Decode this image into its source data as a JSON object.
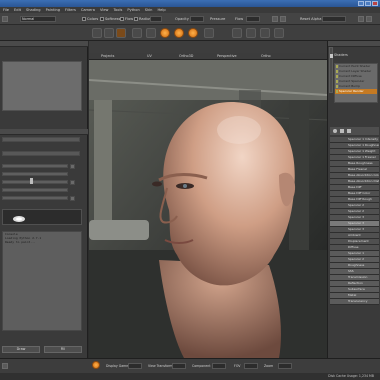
{
  "titlebar": {
    "title": ""
  },
  "menu": [
    "File",
    "Edit",
    "Shading",
    "Painting",
    "Filters",
    "Camera",
    "View",
    "Tools",
    "Python",
    "Skin",
    "Help"
  ],
  "toolbar1": {
    "mode_value": "Normal",
    "labels": [
      "Colors",
      "Softness",
      "Flow",
      "Radius",
      "Opacity",
      "Pressure",
      "Flow",
      "Reset Alpha"
    ]
  },
  "viewport": {
    "tabs": [
      "Projects",
      "UV",
      "Ortho3D",
      "Perspective",
      "Ortho"
    ]
  },
  "leftpanel": {
    "console_lines": [
      "Console",
      "Loading Python 2.7.1",
      "Ready to paint..."
    ],
    "buttons": [
      "Draw",
      "Fill"
    ]
  },
  "rightpanel": {
    "header": "Shaders",
    "list": [
      "Current Paint Shader",
      "Current Layer Shader",
      "Current Diffuse",
      "Current Specular",
      "Current Bump",
      "Specular Render"
    ],
    "selected_index": 5,
    "properties": [
      "Specular 1 Intensity",
      "Specular 1 Roughness",
      "Specular 1 Weight",
      "Specular 1 Fresnel",
      "Base Roughness",
      "Base Fresnel",
      "Base Absorbtion Color",
      "Base Absorbtion Dist",
      "Base Diff",
      "Base Diff Color",
      "Base Diff Rough",
      "Specular 2",
      "Specular 2",
      "Specular 3",
      "Specular 3",
      "Specular 3",
      "Ambient",
      "Displacement",
      "Diffuse",
      "Specular 1",
      "Specular 2",
      "Roughness",
      "SSS",
      "Transmission",
      "Reflection",
      "Subsurface",
      "Metal",
      "Translucency"
    ],
    "highlight_index": 14
  },
  "statusbar": {
    "labels": [
      "Display Gamma",
      "View Transform",
      "Component",
      "FOV",
      "Zoom"
    ]
  },
  "bottom": {
    "text": "Disk Cache Usage: 1,234 MB"
  },
  "colors": {
    "accent": "#c57a23",
    "titlebar": "#2a5594"
  }
}
